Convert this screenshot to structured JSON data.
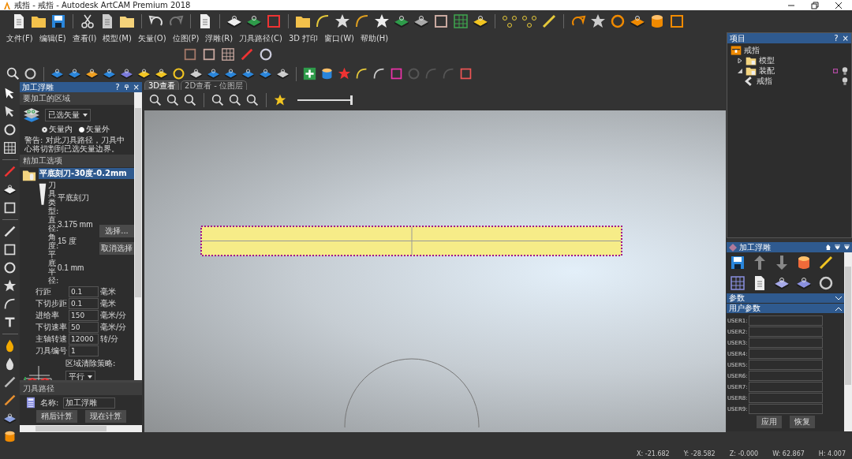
{
  "window": {
    "title": "戒指 - 戒指 - Autodesk ArtCAM Premium 2018"
  },
  "menu": [
    "文件(F)",
    "编辑(E)",
    "查看(I)",
    "模型(M)",
    "矢量(O)",
    "位图(P)",
    "浮雕(R)",
    "刀具路径(C)",
    "3D 打印",
    "窗口(W)",
    "帮助(H)"
  ],
  "left_panel": {
    "title": "加工浮雕",
    "header_buttons": [
      "?",
      "×"
    ],
    "area_section": {
      "title": "要加工的区域",
      "dropdown": "已选矢量",
      "radios": [
        {
          "label": "矢量内",
          "selected": true
        },
        {
          "label": "矢量外",
          "selected": false
        }
      ],
      "warning": "警告: 对此刀具路径，刀具中心将切割到已选矢量边界。"
    },
    "finish_section": {
      "title": "精加工选项",
      "tool_name": "平底刻刀-30度-0.2mm",
      "tool_props": [
        {
          "label": "刀具类型:",
          "value": "平底刻刀"
        },
        {
          "label": "直径:",
          "value": "3.175 mm"
        },
        {
          "label": "角度:",
          "value": "15 度"
        },
        {
          "label": "平底半径:",
          "value": "0.1 mm"
        }
      ],
      "tool_buttons": [
        "选择...",
        "取消选择"
      ],
      "params": [
        {
          "label": "行距",
          "value": "0.1",
          "unit": "毫米"
        },
        {
          "label": "下切步距",
          "value": "0.1",
          "unit": "毫米"
        },
        {
          "label": "进给率",
          "value": "150",
          "unit": "毫米/分"
        },
        {
          "label": "下切速率",
          "value": "50",
          "unit": "毫米/分"
        },
        {
          "label": "主轴转速",
          "value": "12000",
          "unit": "转/分"
        },
        {
          "label": "刀具编号",
          "value": "1"
        }
      ],
      "strategy_label": "区域清除策略:",
      "strategy": "平行"
    },
    "toolpath_section": {
      "title": "刀具路径",
      "name_label": "名称:",
      "name_value": "加工浮雕",
      "buttons": [
        "稍后计算",
        "现在计算"
      ]
    }
  },
  "view_tabs": [
    {
      "label": "3D查看",
      "selected": true
    },
    {
      "label": "2D查看 - 位图层",
      "selected": false
    }
  ],
  "zoom_slider": {
    "level": 1.0
  },
  "project_panel": {
    "title": "项目",
    "header_buttons": [
      "?",
      "×"
    ],
    "tree": [
      {
        "label": "戒指",
        "kind": "root",
        "children": [
          {
            "label": "模型",
            "kind": "folder",
            "expanded": false
          },
          {
            "label": "装配",
            "kind": "folder",
            "expanded": true,
            "children": [
              {
                "label": "戒指",
                "kind": "part"
              }
            ]
          }
        ]
      }
    ]
  },
  "relief_panel": {
    "title": "加工浮雕",
    "sections": [
      {
        "title": "参数",
        "expanded": false
      },
      {
        "title": "用户参数",
        "expanded": true
      }
    ],
    "user_fields": [
      "USER1:",
      "USER2:",
      "USER3:",
      "USER4:",
      "USER5:",
      "USER6:",
      "USER7:",
      "USER8:",
      "USER9:"
    ],
    "buttons": [
      "应用",
      "恢复"
    ]
  },
  "status_bar": [
    "X: -21.682",
    "Y: -28.582",
    "Z: -0.000",
    "W: 62.867",
    "H: 4.007"
  ]
}
